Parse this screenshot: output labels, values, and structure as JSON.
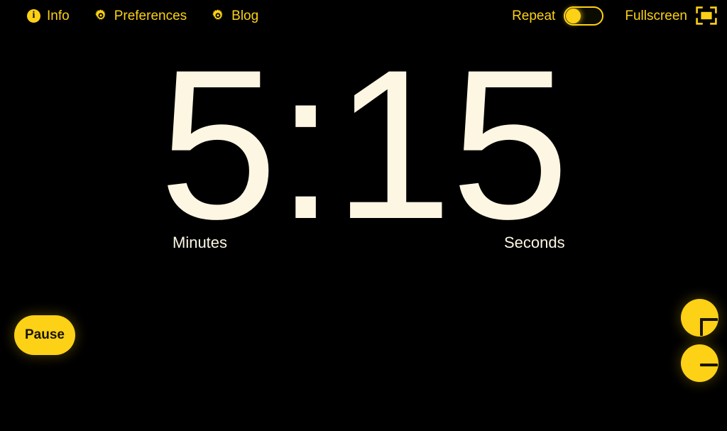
{
  "theme": {
    "background": "#000000",
    "accent": "#FCD116",
    "timer_text": "#FDF6E3",
    "button_text": "#1a1403"
  },
  "topbar": {
    "left_items": [
      {
        "label": "Info",
        "icon": "info-icon"
      },
      {
        "label": "Preferences",
        "icon": "gear-icon"
      },
      {
        "label": "Blog",
        "icon": "gear-icon"
      }
    ],
    "repeat": {
      "label": "Repeat",
      "state": "off",
      "icon": "toggle-switch-icon"
    },
    "fullscreen": {
      "label": "Fullscreen",
      "icon": "fullscreen-icon"
    }
  },
  "timer": {
    "minutes": "5",
    "separator": ":",
    "seconds": "15",
    "display": "5:15",
    "minutes_label": "Minutes",
    "seconds_label": "Seconds"
  },
  "controls": {
    "pause_label": "Pause",
    "increase": {
      "label": "+",
      "icon": "plus-icon"
    },
    "decrease": {
      "label": "−",
      "icon": "minus-icon"
    }
  }
}
